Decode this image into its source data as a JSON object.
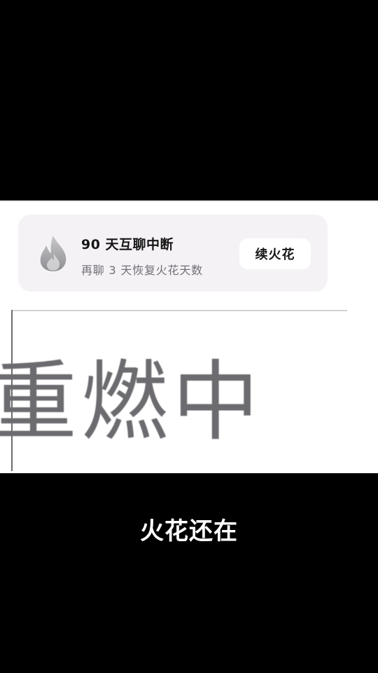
{
  "notification": {
    "icon": "flame-icon",
    "title": "90 天互聊中断",
    "subtitle": "再聊 3 天恢复火花天数",
    "button_label": "续火花"
  },
  "zoom": {
    "text": "重燃中"
  },
  "caption": {
    "text": "火花还在"
  },
  "colors": {
    "background": "#000000",
    "card_background": "#f5f2f6",
    "button_background": "#ffffff",
    "title_text": "#161616",
    "subtitle_text": "#6f6f76",
    "zoom_text": "#6c6c70",
    "caption_text": "#ffffff"
  }
}
